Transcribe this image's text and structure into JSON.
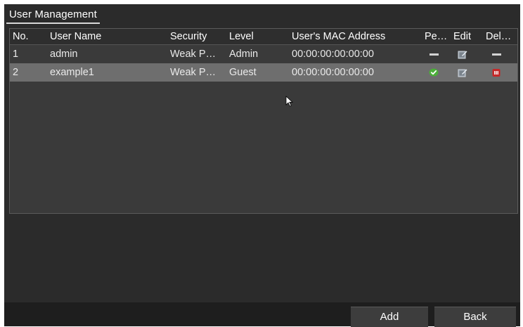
{
  "window": {
    "tab_label": "User Management"
  },
  "table": {
    "headers": {
      "no": "No.",
      "user_name": "User Name",
      "security": "Security",
      "level": "Level",
      "mac": "User's MAC Address",
      "permission": "Pe…",
      "edit": "Edit",
      "delete": "Del…"
    },
    "rows": [
      {
        "no": "1",
        "user_name": "admin",
        "security": "Weak P…",
        "level": "Admin",
        "mac": "00:00:00:00:00:00",
        "permission_icon": "dash-icon",
        "edit_icon": "edit-icon",
        "delete_icon": "dash-icon"
      },
      {
        "no": "2",
        "user_name": "example1",
        "security": "Weak P…",
        "level": "Guest",
        "mac": "00:00:00:00:00:00",
        "permission_icon": "check-icon",
        "edit_icon": "edit-icon",
        "delete_icon": "trash-icon"
      }
    ]
  },
  "footer": {
    "add_label": "Add",
    "back_label": "Back"
  },
  "colors": {
    "background": "#2b2b2b",
    "selected_row": "#6e6e6e",
    "check_green": "#4caf3a",
    "delete_red": "#c62828"
  }
}
